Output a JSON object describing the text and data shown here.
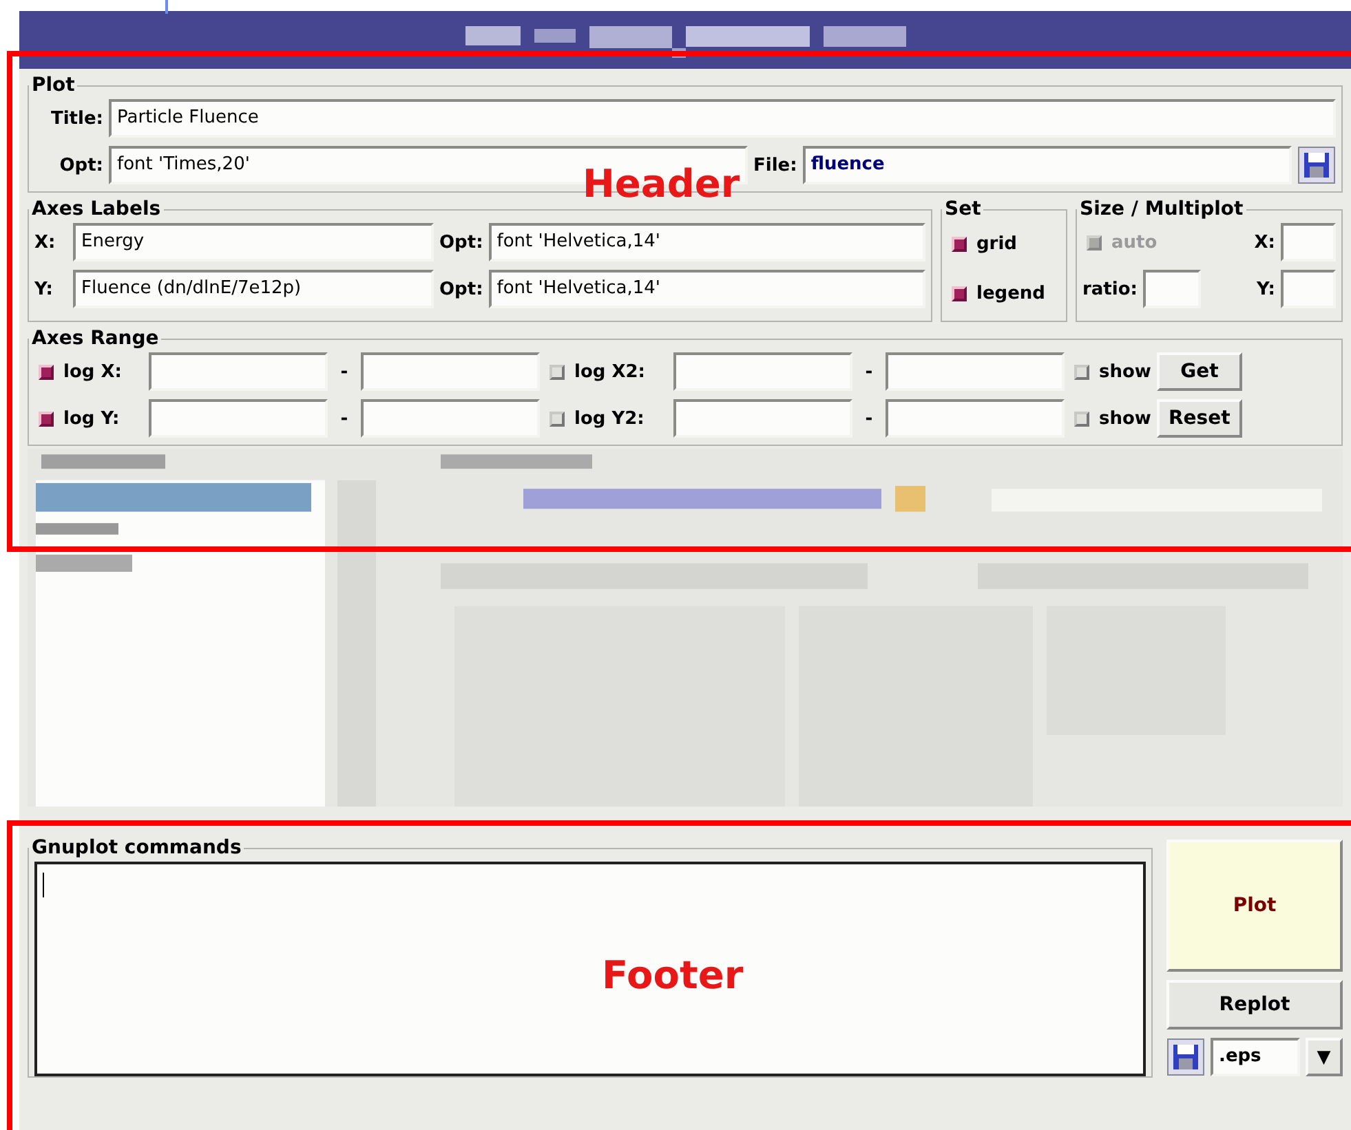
{
  "plot": {
    "legend": "Plot",
    "title_label": "Title:",
    "title_value": "Particle Fluence",
    "opt_label": "Opt:",
    "opt_value": "font 'Times,20'",
    "file_label": "File:",
    "file_value": "fluence"
  },
  "axes_labels": {
    "legend": "Axes Labels",
    "rows": [
      {
        "label": "X:",
        "value": "Energy",
        "opt_label": "Opt:",
        "opt_value": "font 'Helvetica,14'"
      },
      {
        "label": "Y:",
        "value": "Fluence (dn/dlnE/7e12p)",
        "opt_label": "Opt:",
        "opt_value": "font 'Helvetica,14'"
      }
    ]
  },
  "set": {
    "legend": "Set",
    "items": [
      {
        "label": "grid",
        "checked": true
      },
      {
        "label": "legend",
        "checked": true
      }
    ]
  },
  "size": {
    "legend": "Size / Multiplot",
    "auto": {
      "label": "auto",
      "checked": true,
      "disabled": true
    },
    "x_label": "X:",
    "ratio_label": "ratio:",
    "y_label": "Y:"
  },
  "axes_range": {
    "legend": "Axes Range",
    "rows": [
      {
        "log_label": "log X:",
        "log_checked": true,
        "dash_1": "-",
        "log2_label": "log X2:",
        "log2_checked": false,
        "dash_2": "-",
        "show_label": "show",
        "show_checked": false,
        "button": "Get"
      },
      {
        "log_label": "log Y:",
        "log_checked": true,
        "dash_1": "-",
        "log2_label": "log Y2:",
        "log2_checked": false,
        "dash_2": "-",
        "show_label": "show",
        "show_checked": false,
        "button": "Reset"
      }
    ]
  },
  "commands": {
    "legend": "Gnuplot commands"
  },
  "buttons": {
    "plot": "Plot",
    "replot": "Replot",
    "format": ".eps",
    "dropdown": "▼"
  },
  "annotations": [
    {
      "label": "Header"
    },
    {
      "label": "Footer"
    }
  ]
}
